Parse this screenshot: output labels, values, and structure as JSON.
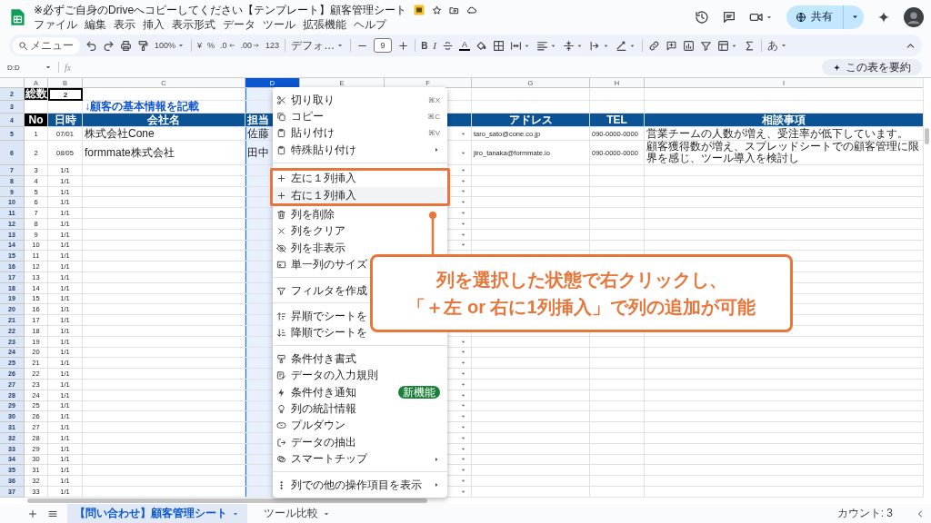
{
  "window": {
    "title": "※必ずご自身のDriveへコピーしてください【テンプレート】顧客管理シート"
  },
  "menu_bar": [
    "ファイル",
    "編集",
    "表示",
    "挿入",
    "表示形式",
    "データ",
    "ツール",
    "拡張機能",
    "ヘルプ"
  ],
  "share_button": {
    "label": "共有"
  },
  "toolbar": {
    "search_placeholder": "メニュー",
    "zoom": "100%",
    "currency": "¥",
    "percent": "%",
    "decrease_decimal": ".0",
    "increase_decimal": ".00",
    "number_format": "123",
    "font": "デフォ…",
    "font_size": "9",
    "bold": "B",
    "italic": "I",
    "text_color": "A",
    "input_tools": "あ"
  },
  "formula_bar": {
    "name_box": "D:D",
    "fx": "fx"
  },
  "summarize_chip": {
    "label": "この表を要約"
  },
  "sheet": {
    "columns": [
      {
        "letter": "A",
        "selected": false
      },
      {
        "letter": "B",
        "selected": false
      },
      {
        "letter": "C",
        "selected": false
      },
      {
        "letter": "D",
        "selected": true
      },
      {
        "letter": "E",
        "selected": false
      },
      {
        "letter": "F",
        "selected": false
      },
      {
        "letter": "G",
        "selected": false
      },
      {
        "letter": "H",
        "selected": false
      },
      {
        "letter": "I",
        "selected": false
      }
    ],
    "rows": [
      {
        "num": "2",
        "kind": "summary",
        "a": "総数",
        "b": "2"
      },
      {
        "num": "3",
        "kind": "note",
        "c": "↓顧客の基本情報を記載"
      },
      {
        "num": "4",
        "kind": "header",
        "a": "No",
        "b": "日時",
        "c": "会社名",
        "d": "担当",
        "g": "アドレス",
        "h": "TEL",
        "i": "相談事項"
      },
      {
        "num": "5",
        "kind": "data",
        "a": "1",
        "b": "07/01",
        "c": "株式会社Cone",
        "d": "佐藤",
        "g": "taro_sato@cone.co.jp",
        "h": "090-0000-0000",
        "i": "営業チームの人数が増え、受注率が低下しています。"
      },
      {
        "num": "6",
        "kind": "data",
        "a": "2",
        "b": "08/05",
        "c": "formmate株式会社",
        "d": "田中",
        "g": "jiro_tanaka@formmate.io",
        "h": "090-0000-0000",
        "i": "顧客獲得数が増え、スプレッドシートでの顧客管理に限界を感じ、ツール導入を検討し"
      },
      {
        "num": "7",
        "kind": "data",
        "a": "3",
        "b": "1/1"
      },
      {
        "num": "8",
        "kind": "data",
        "a": "4",
        "b": "1/1"
      },
      {
        "num": "9",
        "kind": "data",
        "a": "5",
        "b": "1/1"
      },
      {
        "num": "10",
        "kind": "data",
        "a": "6",
        "b": "1/1"
      },
      {
        "num": "11",
        "kind": "data",
        "a": "7",
        "b": "1/1"
      },
      {
        "num": "12",
        "kind": "data",
        "a": "8",
        "b": "1/1"
      },
      {
        "num": "13",
        "kind": "data",
        "a": "9",
        "b": "1/1"
      },
      {
        "num": "14",
        "kind": "data",
        "a": "10",
        "b": "1/1"
      },
      {
        "num": "15",
        "kind": "data",
        "a": "11",
        "b": "1/1"
      },
      {
        "num": "16",
        "kind": "data",
        "a": "12",
        "b": "1/1"
      },
      {
        "num": "17",
        "kind": "data",
        "a": "13",
        "b": "1/1"
      },
      {
        "num": "18",
        "kind": "data",
        "a": "14",
        "b": "1/1"
      },
      {
        "num": "19",
        "kind": "data",
        "a": "15",
        "b": "1/1"
      },
      {
        "num": "20",
        "kind": "data",
        "a": "16",
        "b": "1/1"
      },
      {
        "num": "21",
        "kind": "data",
        "a": "17",
        "b": "1/1"
      },
      {
        "num": "22",
        "kind": "data",
        "a": "18",
        "b": "1/1"
      },
      {
        "num": "23",
        "kind": "data",
        "a": "19",
        "b": "1/1"
      },
      {
        "num": "24",
        "kind": "data",
        "a": "20",
        "b": "1/1"
      },
      {
        "num": "25",
        "kind": "data",
        "a": "21",
        "b": "1/1"
      },
      {
        "num": "26",
        "kind": "data",
        "a": "22",
        "b": "1/1"
      },
      {
        "num": "27",
        "kind": "data",
        "a": "23",
        "b": "1/1"
      },
      {
        "num": "28",
        "kind": "data",
        "a": "24",
        "b": "1/1"
      },
      {
        "num": "29",
        "kind": "data",
        "a": "25",
        "b": "1/1"
      },
      {
        "num": "30",
        "kind": "data",
        "a": "26",
        "b": "1/1"
      },
      {
        "num": "31",
        "kind": "data",
        "a": "27",
        "b": "1/1"
      },
      {
        "num": "32",
        "kind": "data",
        "a": "28",
        "b": "1/1"
      },
      {
        "num": "33",
        "kind": "data",
        "a": "29",
        "b": "1/1"
      },
      {
        "num": "34",
        "kind": "data",
        "a": "30",
        "b": "1/1"
      },
      {
        "num": "35",
        "kind": "data",
        "a": "31",
        "b": "1/1"
      },
      {
        "num": "36",
        "kind": "data",
        "a": "32",
        "b": "1/1"
      },
      {
        "num": "37",
        "kind": "data",
        "a": "33",
        "b": "1/1"
      }
    ]
  },
  "context_menu": {
    "items": [
      {
        "kind": "item",
        "label": "切り取り",
        "shortcut": "⌘X",
        "hovered": false
      },
      {
        "kind": "item",
        "label": "コピー",
        "shortcut": "⌘C",
        "hovered": false
      },
      {
        "kind": "item",
        "label": "貼り付け",
        "shortcut": "⌘V",
        "hovered": false
      },
      {
        "kind": "item",
        "label": "特殊貼り付け",
        "has_submenu": true,
        "hovered": false
      },
      {
        "kind": "divider"
      },
      {
        "kind": "item",
        "label": "左に１列挿入",
        "highlight_frame": true,
        "hovered": false
      },
      {
        "kind": "item",
        "label": "右に１列挿入",
        "highlight_frame": true,
        "hovered": true
      },
      {
        "kind": "item",
        "label": "列を削除",
        "hovered": false
      },
      {
        "kind": "item",
        "label": "列をクリア",
        "hovered": false
      },
      {
        "kind": "item",
        "label": "列を非表示",
        "hovered": false
      },
      {
        "kind": "item",
        "label": "単一列のサイズ",
        "hovered": false
      },
      {
        "kind": "divider"
      },
      {
        "kind": "item",
        "label": "フィルタを作成",
        "hovered": false
      },
      {
        "kind": "divider"
      },
      {
        "kind": "item",
        "label": "昇順でシートを",
        "hovered": false
      },
      {
        "kind": "item",
        "label": "降順でシートを",
        "hovered": false
      },
      {
        "kind": "divider"
      },
      {
        "kind": "item",
        "label": "条件付き書式",
        "hovered": false
      },
      {
        "kind": "item",
        "label": "データの入力規則",
        "hovered": false
      },
      {
        "kind": "item",
        "label": "条件付き通知",
        "badge": "新機能",
        "hovered": false
      },
      {
        "kind": "item",
        "label": "列の統計情報",
        "hovered": false
      },
      {
        "kind": "item",
        "label": "プルダウン",
        "hovered": false
      },
      {
        "kind": "item",
        "label": "データの抽出",
        "hovered": false
      },
      {
        "kind": "item",
        "label": "スマートチップ",
        "has_submenu": true,
        "hovered": false
      },
      {
        "kind": "divider"
      },
      {
        "kind": "item",
        "label": "列での他の操作項目を表示",
        "has_submenu": true,
        "hovered": false
      }
    ]
  },
  "annotation": {
    "lines": [
      "列を選択した状態で右クリックし、",
      "「＋左 or 右に1列挿入」で列の追加が可能"
    ]
  },
  "sheet_tabs": [
    {
      "label": "【問い合わせ】顧客管理シート",
      "selected": true
    },
    {
      "label": "ツール比較",
      "selected": false
    }
  ],
  "status": {
    "count": "カウント: 3"
  }
}
